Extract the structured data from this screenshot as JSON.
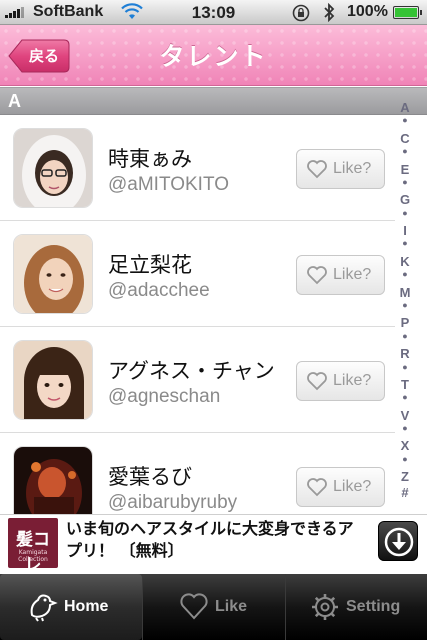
{
  "status_bar": {
    "carrier": "SoftBank",
    "time": "13:09",
    "battery": "100%"
  },
  "nav": {
    "back_label": "戻る",
    "title": "タレント"
  },
  "section": {
    "header": "A"
  },
  "talents": [
    {
      "name": "時東ぁみ",
      "handle": "@aMITOKITO",
      "like_label": "Like?"
    },
    {
      "name": "足立梨花",
      "handle": "@adacchee",
      "like_label": "Like?"
    },
    {
      "name": "アグネス・チャン",
      "handle": "@agneschan",
      "like_label": "Like?"
    },
    {
      "name": "愛葉るび",
      "handle": "@aibarubyruby",
      "like_label": "Like?"
    }
  ],
  "index_letters": [
    "A",
    "●",
    "C",
    "●",
    "E",
    "●",
    "G",
    "●",
    "I",
    "●",
    "K",
    "●",
    "M",
    "●",
    "P",
    "●",
    "R",
    "●",
    "T",
    "●",
    "V",
    "●",
    "X",
    "●",
    "Z",
    "#"
  ],
  "ad": {
    "logo_kanji": "髪コレ",
    "logo_caption": "Kamigata Collection",
    "text": "いま旬のヘアスタイルに大変身できるアプリ！ 〔無料〕"
  },
  "tabs": [
    {
      "label": "Home",
      "icon": "bird-icon",
      "active": true
    },
    {
      "label": "Like",
      "icon": "heart-icon",
      "active": false
    },
    {
      "label": "Setting",
      "icon": "gear-icon",
      "active": false
    }
  ],
  "colors": {
    "nav_pink": "#f69fc6",
    "back_button": "#e0457f",
    "battery_green": "#35c335"
  }
}
